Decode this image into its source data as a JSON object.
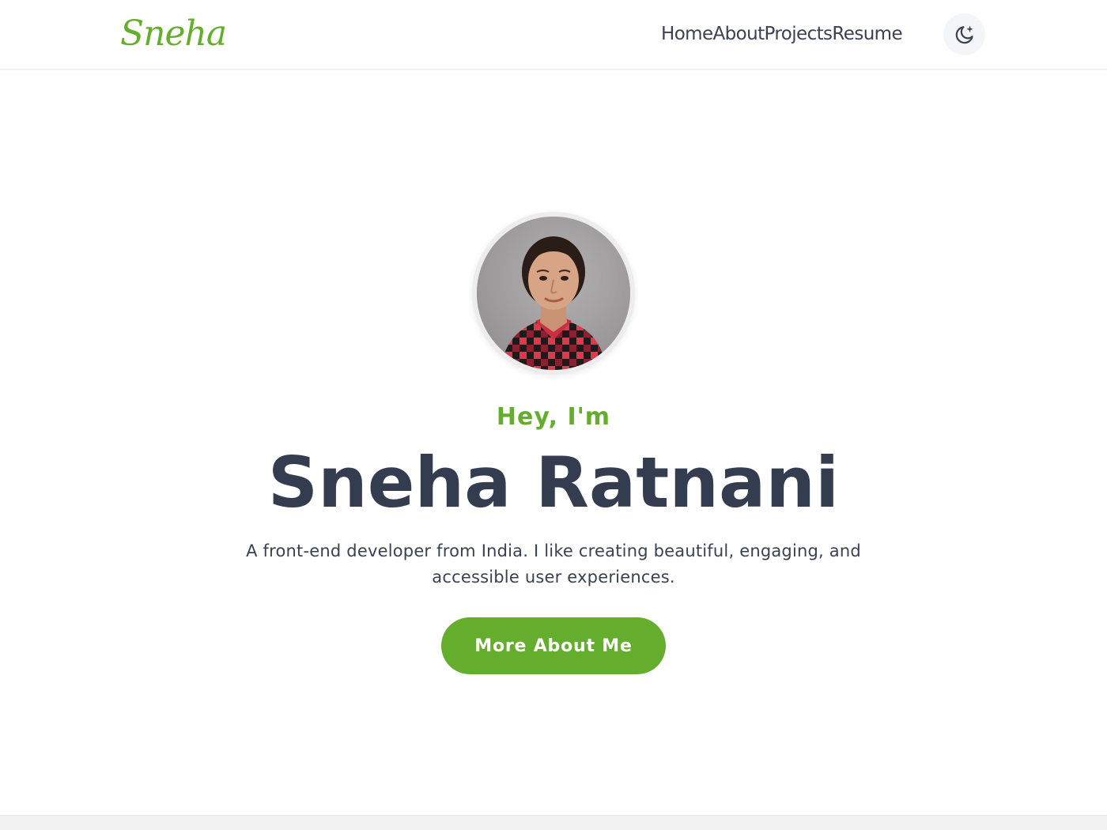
{
  "header": {
    "logo_text": "Sneha",
    "nav": [
      {
        "label": "Home"
      },
      {
        "label": "About"
      },
      {
        "label": "Projects"
      },
      {
        "label": "Resume"
      }
    ],
    "theme_toggle_icon": "moon-stars-icon"
  },
  "hero": {
    "avatar_icon": "profile-photo",
    "greeting": "Hey, I'm",
    "name": "Sneha Ratnani",
    "tagline": "A front-end developer from India. I like creating beautiful, engaging, and accessible user experiences.",
    "cta_label": "More About Me"
  },
  "colors": {
    "accent": "#65ad2c",
    "heading": "#333d4f",
    "text": "#3a4150",
    "toggle_bg": "#f4f5f8"
  }
}
